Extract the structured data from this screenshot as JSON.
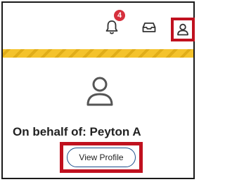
{
  "header": {
    "notifications": {
      "icon": "bell-icon",
      "badge_count": "4"
    },
    "inbox": {
      "icon": "inbox-icon"
    },
    "profile": {
      "icon": "user-icon"
    }
  },
  "profile_panel": {
    "avatar_icon": "user-icon",
    "on_behalf_text": "On behalf of: Peyton A",
    "view_profile_label": "View Profile"
  },
  "colors": {
    "highlight_border": "#c0111f",
    "badge": "#d6303d",
    "stripe_primary": "#f4c32c",
    "stripe_secondary": "#e0ad18",
    "button_border": "#1e4f8c"
  }
}
